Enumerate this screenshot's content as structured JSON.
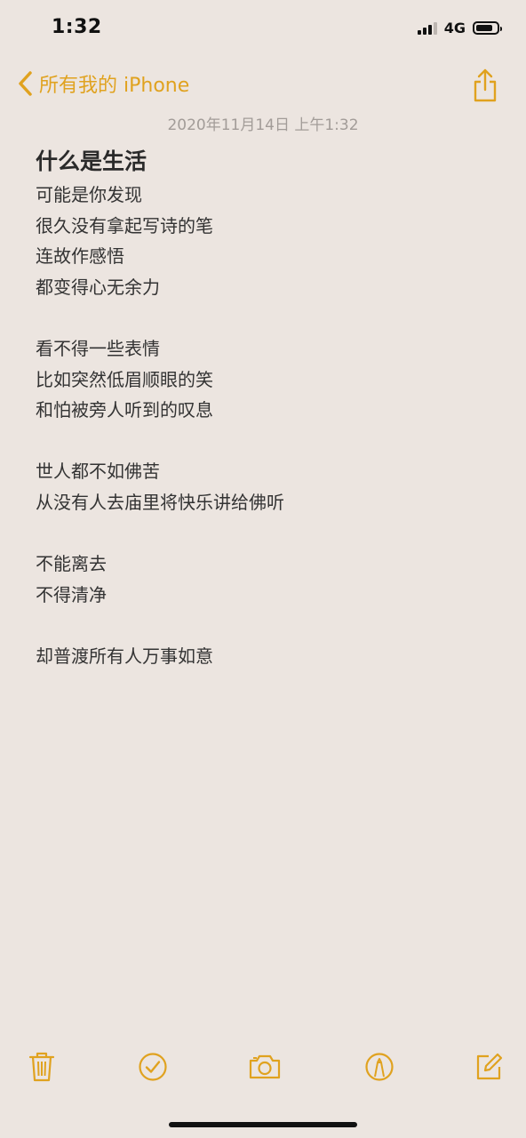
{
  "status_bar": {
    "time": "1:32",
    "network": "4G"
  },
  "nav": {
    "back_label": "所有我的 iPhone",
    "back_icon": "chevron-left-icon",
    "share_icon": "share-icon"
  },
  "note": {
    "date": "2020年11月14日 上午1:32",
    "title": "什么是生活",
    "lines": [
      "可能是你发现",
      "很久没有拿起写诗的笔",
      "连故作感悟",
      "都变得心无余力",
      "",
      "看不得一些表情",
      "比如突然低眉顺眼的笑",
      "和怕被旁人听到的叹息",
      "",
      "世人都不如佛苦",
      "从没有人去庙里将快乐讲给佛听",
      "",
      "不能离去",
      "不得清净",
      "",
      "却普渡所有人万事如意"
    ]
  },
  "toolbar": {
    "items": [
      "trash-icon",
      "checklist-icon",
      "camera-icon",
      "markup-icon",
      "compose-icon"
    ]
  },
  "colors": {
    "accent": "#e0a21f",
    "background": "#ece5e0",
    "text": "#333333",
    "date_text": "#a29c98"
  }
}
